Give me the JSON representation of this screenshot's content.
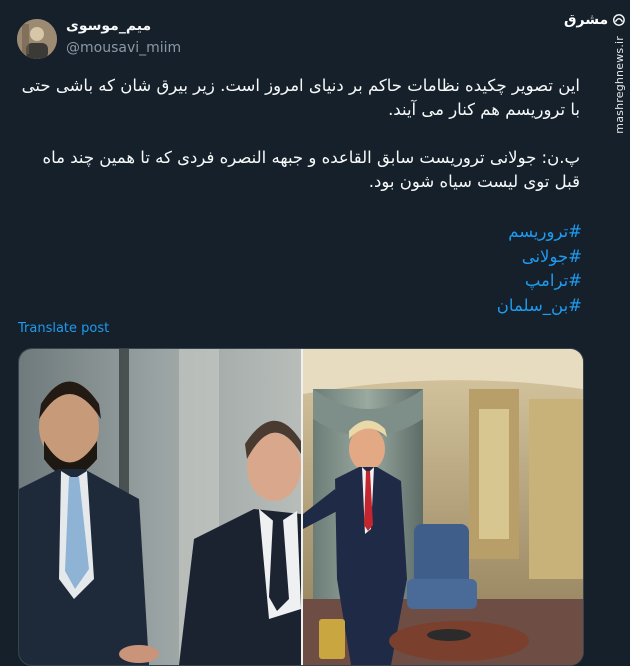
{
  "author": {
    "display_name": "میم_موسوی",
    "handle": "@mousavi_miim"
  },
  "tweet": {
    "paragraphs": [
      "این تصویر چکیده نظامات حاکم بر دنیای امروز است. زیر بیرق شان که باشی حتی با تروریسم هم کنار می آیند.",
      "پ.ن: جولانی تروریست سابق القاعده و جبهه النصره فردی که تا همین چند ماه قبل توی لیست سیاه شون بود."
    ],
    "hashtags": [
      "#تروریسم",
      "#جولانی",
      "#ترامپ",
      "#بن_سلمان"
    ],
    "translate_label": "Translate post"
  },
  "watermark": {
    "logo_text": "مشرق",
    "url": "mashreghnews.ir"
  },
  "colors": {
    "background": "#15202b",
    "link": "#1d9bf0",
    "secondary_text": "#8b98a5"
  },
  "icons": {
    "watermark_logo": "mashregh-logo-icon"
  }
}
